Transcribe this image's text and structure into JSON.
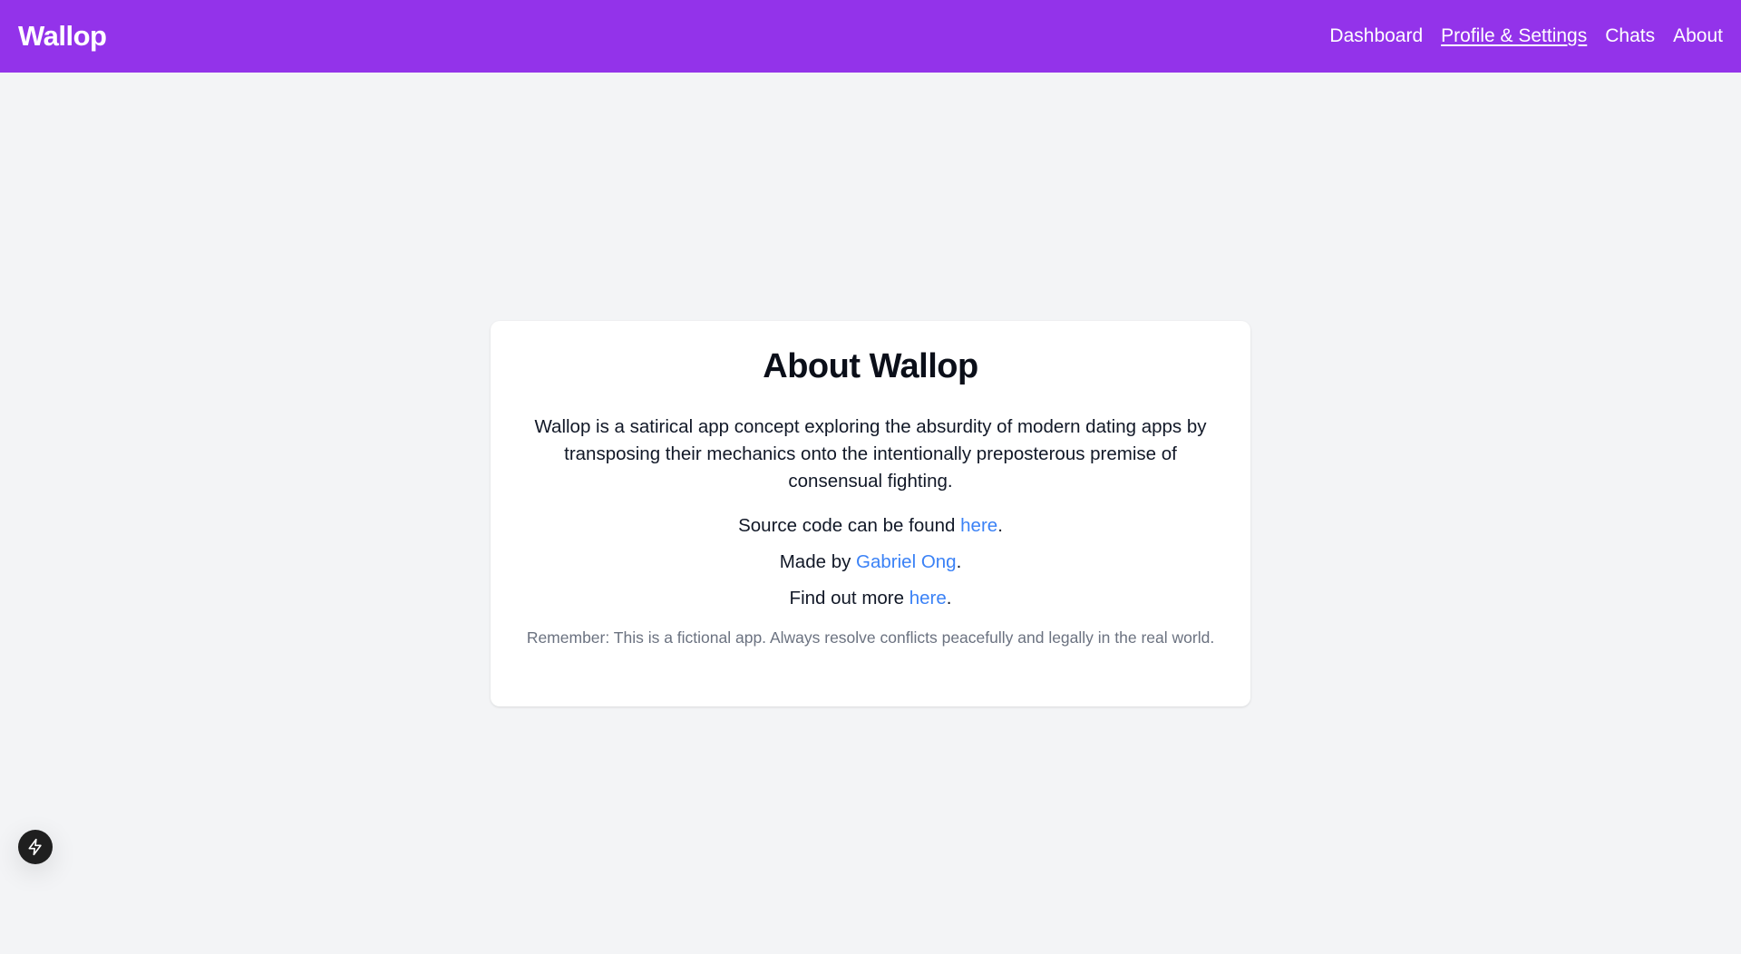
{
  "header": {
    "brand": "Wallop",
    "nav": [
      {
        "label": "Dashboard",
        "active": false
      },
      {
        "label": "Profile & Settings",
        "active": true
      },
      {
        "label": "Chats",
        "active": false
      },
      {
        "label": "About",
        "active": false
      }
    ]
  },
  "about": {
    "title": "About Wallop",
    "description": "Wallop is a satirical app concept exploring the absurdity of modern dating apps by transposing their mechanics onto the intentionally preposterous premise of consensual fighting.",
    "source": {
      "prefix": "Source code can be found ",
      "link": "here",
      "suffix": "."
    },
    "author": {
      "prefix": "Made by ",
      "link": "Gabriel Ong",
      "suffix": "."
    },
    "more": {
      "prefix": "Find out more ",
      "link": "here",
      "suffix": "."
    },
    "disclaimer": "Remember: This is a fictional app. Always resolve conflicts peacefully and legally in the real world."
  },
  "dev_tools": {
    "icon": "lightning-bolt-icon"
  },
  "colors": {
    "header_bg": "#9333ea",
    "page_bg": "#f3f4f6",
    "link": "#3b82f6",
    "muted_text": "#6b7280"
  }
}
